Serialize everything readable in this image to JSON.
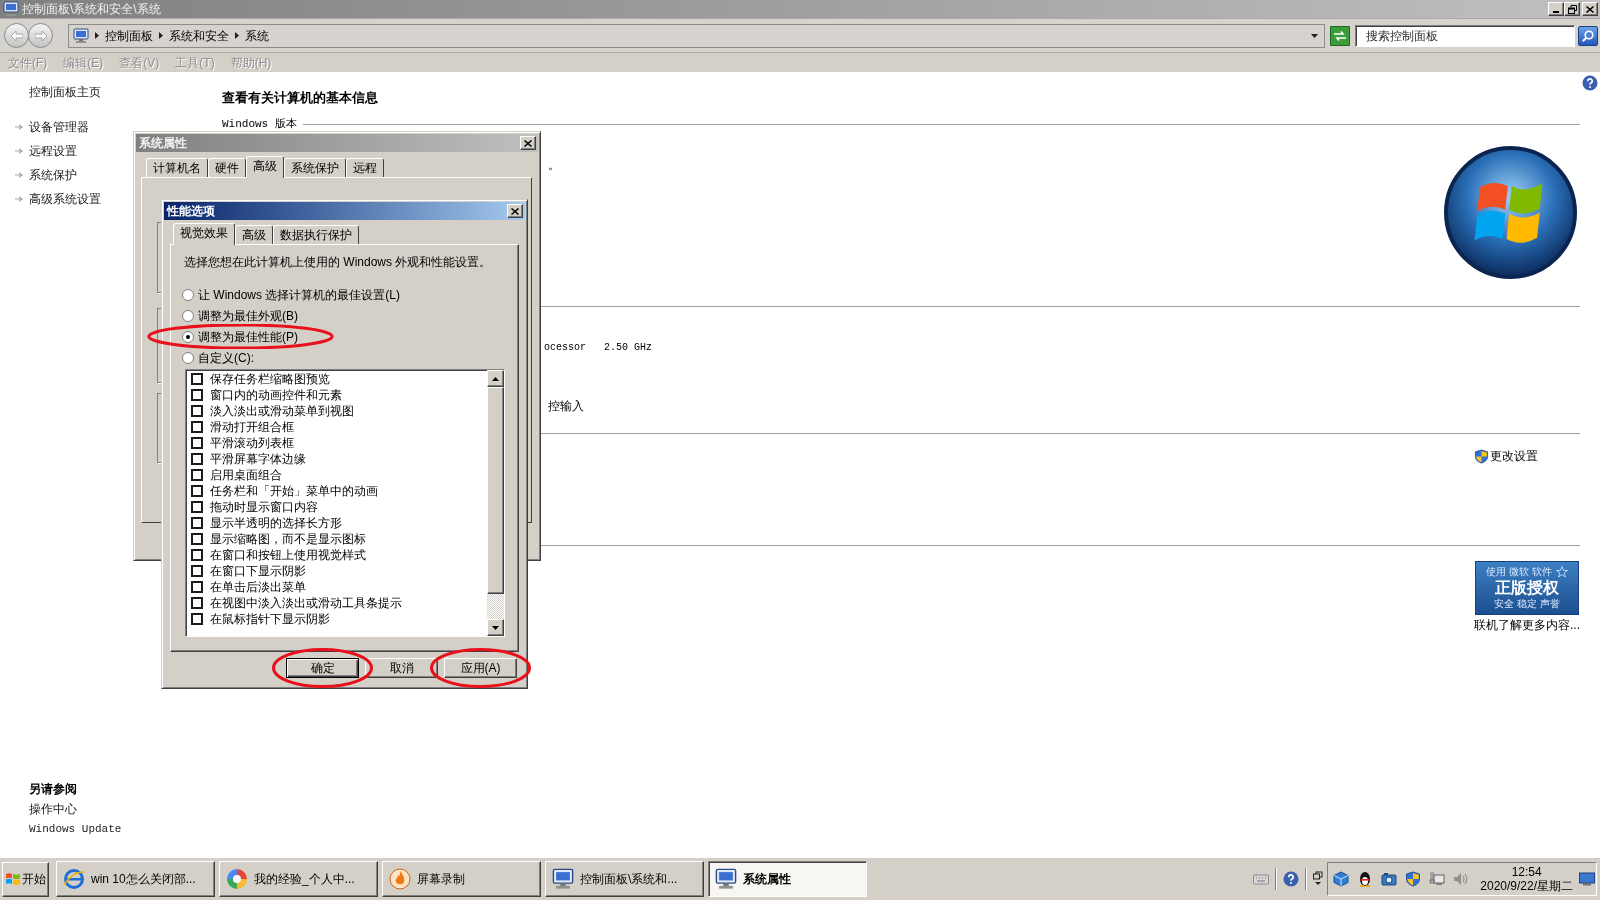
{
  "window": {
    "title": "控制面板\\系统和安全\\系统",
    "active": false
  },
  "address_bar": {
    "breadcrumbs": [
      "控制面板",
      "系统和安全",
      "系统"
    ]
  },
  "search": {
    "placeholder": "搜索控制面板"
  },
  "menu": [
    {
      "label": "文件(F)",
      "disabled": true
    },
    {
      "label": "编辑(E)",
      "disabled": true
    },
    {
      "label": "查看(V)",
      "disabled": true
    },
    {
      "label": "工具(T)",
      "disabled": true
    },
    {
      "label": "帮助(H)",
      "disabled": true
    }
  ],
  "sidebar": {
    "home": "控制面板主页",
    "tasks": [
      "设备管理器",
      "远程设置",
      "系统保护",
      "高级系统设置"
    ],
    "see_also": {
      "title": "另请参阅",
      "links": [
        "操作中心",
        "Windows Update"
      ]
    }
  },
  "main": {
    "heading": "查看有关计算机的基本信息",
    "edition_label": "Windows 版本",
    "edition_fragment": "。",
    "processor_fragment": "ocessor   2.50 GHz",
    "pen_touch_fragment": "控输入",
    "change_settings": "更改设置",
    "genuine_badge": {
      "line_1": "使用 微软 软件",
      "line_2": "正版授权",
      "line_3": "安全 稳定 声誉"
    },
    "genuine_link": "联机了解更多内容..."
  },
  "system_properties": {
    "title": "系统属性",
    "active": false,
    "tabs": [
      {
        "label": "计算机名",
        "selected": false
      },
      {
        "label": "硬件",
        "selected": false
      },
      {
        "label": "高级",
        "selected": true
      },
      {
        "label": "系统保护",
        "selected": false
      },
      {
        "label": "远程",
        "selected": false
      }
    ]
  },
  "performance_options": {
    "title": "性能选项",
    "active": true,
    "tabs": [
      {
        "label": "视觉效果",
        "selected": true
      },
      {
        "label": "高级",
        "selected": false
      },
      {
        "label": "数据执行保护",
        "selected": false
      }
    ],
    "description": "选择您想在此计算机上使用的 Windows 外观和性能设置。",
    "radios": [
      {
        "label": "让 Windows 选择计算机的最佳设置(L)",
        "selected": false,
        "circled": false
      },
      {
        "label": "调整为最佳外观(B)",
        "selected": false,
        "circled": false
      },
      {
        "label": "调整为最佳性能(P)",
        "selected": true,
        "circled": true
      },
      {
        "label": "自定义(C):",
        "selected": false,
        "circled": false
      }
    ],
    "effects": [
      {
        "label": "保存任务栏缩略图预览",
        "checked": false
      },
      {
        "label": "窗口内的动画控件和元素",
        "checked": false
      },
      {
        "label": "淡入淡出或滑动菜单到视图",
        "checked": false
      },
      {
        "label": "滑动打开组合框",
        "checked": false
      },
      {
        "label": "平滑滚动列表框",
        "checked": false
      },
      {
        "label": "平滑屏幕字体边缘",
        "checked": false
      },
      {
        "label": "启用桌面组合",
        "checked": false
      },
      {
        "label": "任务栏和「开始」菜单中的动画",
        "checked": false
      },
      {
        "label": "拖动时显示窗口内容",
        "checked": false
      },
      {
        "label": "显示半透明的选择长方形",
        "checked": false
      },
      {
        "label": "显示缩略图，而不是显示图标",
        "checked": false
      },
      {
        "label": "在窗口和按钮上使用视觉样式",
        "checked": false
      },
      {
        "label": "在窗口下显示阴影",
        "checked": false
      },
      {
        "label": "在单击后淡出菜单",
        "checked": false
      },
      {
        "label": "在视图中淡入淡出或滑动工具条提示",
        "checked": false
      },
      {
        "label": "在鼠标指针下显示阴影",
        "checked": false
      }
    ],
    "buttons": [
      {
        "label": "确定",
        "default": true,
        "circled": true
      },
      {
        "label": "取消",
        "default": false,
        "circled": false
      },
      {
        "label": "应用(A)",
        "default": false,
        "circled": true
      }
    ]
  },
  "taskbar": {
    "start": "开始",
    "tasks": [
      {
        "label": "win 10怎么关闭部...",
        "selected": false
      },
      {
        "label": "我的经验_个人中...",
        "selected": false
      },
      {
        "label": "屏幕录制",
        "selected": false
      },
      {
        "label": "控制面板\\系统和...",
        "selected": false
      },
      {
        "label": "系统属性",
        "selected": true
      }
    ],
    "clock": {
      "time": "12:54",
      "date": "2020/9/22/星期二"
    }
  }
}
